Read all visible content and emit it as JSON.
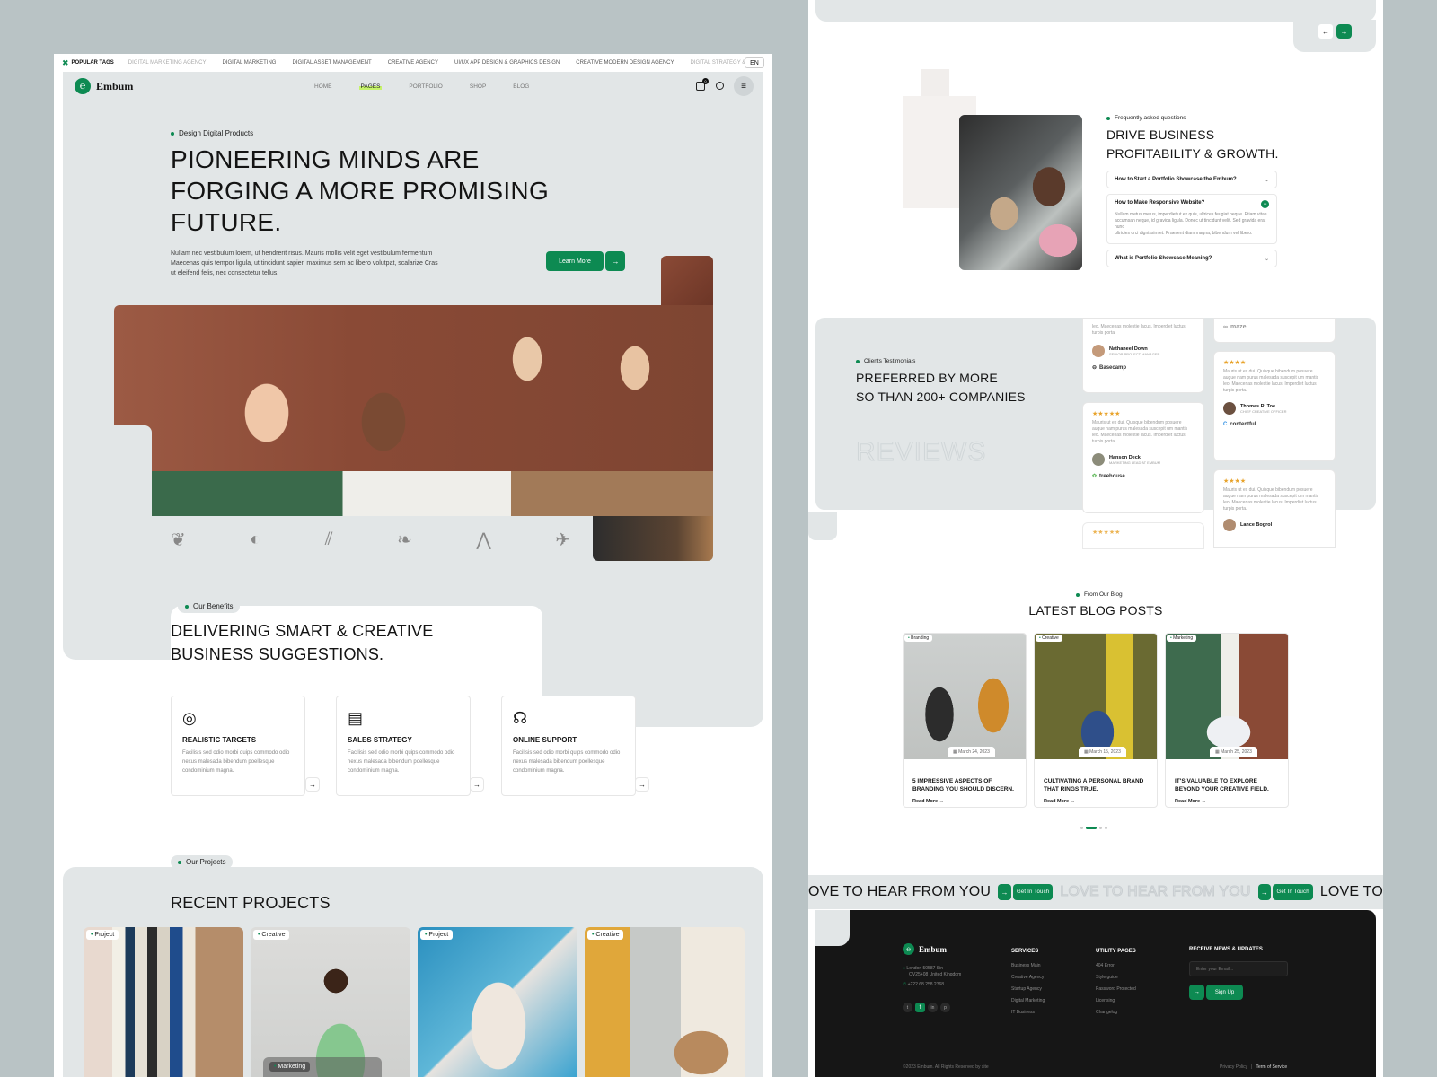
{
  "topbar": {
    "label": "POPULAR TAGS",
    "tags": [
      "DIGITAL MARKETING AGENCY",
      "DIGITAL MARKETING",
      "DIGITAL ASSET MANAGEMENT",
      "CREATIVE AGENCY",
      "UI/UX APP DESIGN & GRAPHICS DESIGN",
      "CREATIVE MODERN DESIGN AGENCY",
      "DIGITAL STRATEGY & BRA"
    ],
    "lang": "EN"
  },
  "brand": "Embum",
  "nav": [
    "HOME",
    "PAGES",
    "PORTFOLIO",
    "SHOP",
    "BLOG"
  ],
  "cart_count": "0",
  "hero": {
    "eyebrow": "Design Digital Products",
    "title_lines": [
      "PIONEERING MINDS ARE",
      "FORGING A MORE PROMISING",
      "FUTURE."
    ],
    "text_lines": [
      "Nullam nec vestibulum lorem, ut hendrerit risus. Mauris mollis velit eget vestibulum fermentum",
      "Maecenas quis tempor ligula, ut tincidunt sapien maximus sem ac libero volutpat, scalarize Cras",
      "ut eleifend felis, nec consectetur tellus."
    ],
    "button": "Learn More"
  },
  "benefits": {
    "eyebrow": "Our Benefits",
    "title_lines": [
      "DELIVERING SMART & CREATIVE",
      "BUSINESS SUGGESTIONS."
    ],
    "cards": [
      {
        "title": "REALISTIC TARGETS",
        "text_lines": [
          "Facilisis sed odio morbi quips commodo odio",
          "nexus malesada bibendum poellesque",
          "condominium magna."
        ]
      },
      {
        "title": "SALES STRATEGY",
        "text_lines": [
          "Facilisis sed odio morbi quips commodo odio",
          "nexus malesada bibendum poellesque",
          "condominium magna."
        ]
      },
      {
        "title": "ONLINE SUPPORT",
        "text_lines": [
          "Facilisis sed odio morbi quips commodo odio",
          "nexus malesada bibendum poellesque",
          "condominium magna."
        ]
      }
    ]
  },
  "projects": {
    "eyebrow": "Our Projects",
    "title": "RECENT PROJECTS",
    "tags": [
      "Project",
      "Creative",
      "Project",
      "Creative"
    ],
    "overlay": "Marketing"
  },
  "faq": {
    "eyebrow": "Frequently asked questions",
    "title_lines": [
      "DRIVE BUSINESS",
      "PROFITABILITY & GROWTH."
    ],
    "items": [
      {
        "q": "How to Start a Portfolio Showcase the Embum?"
      },
      {
        "q": "How to Make Responsive Website?",
        "a_lines": [
          "Nullam metus metus, imperdiet ut ex quis, ultrices feugiat neque. Etiam vitae",
          "accumsan neque, id gravida ligula. Donec ut tincidunt velit. Sed gravida erat nunc",
          "ultricies orci dignissim et. Praesent diam magna, bibendum vel libero."
        ]
      },
      {
        "q": "What is Portfolio Showcase Meaning?"
      }
    ]
  },
  "testimonials": {
    "eyebrow": "Clients Testimonials",
    "title_lines": [
      "PREFERRED BY MORE",
      "SO THAN 200+ COMPANIES"
    ],
    "watermark": "REVIEWS",
    "col1": [
      {
        "text_lines": [
          "leo. Maecenas molestie lacus. Imperdiet luctus",
          "turpis porta."
        ],
        "name": "Nathaneel Down",
        "role": "SENIOR PROJECT MANAGER",
        "logo": "Basecamp"
      },
      {
        "stars": "★★★★★",
        "text_lines": [
          "Mauris ut ex dui. Quisque bibendum posuere",
          "augue nam purus malesada suscepit um mantis",
          "leo. Maecenas molestie lacus. Imperdiet luctus",
          "turpis porta."
        ],
        "name": "Hanson Deck",
        "role": "MARKETING LEAD AT EMBUM",
        "logo": "treehouse"
      },
      {
        "stars": "★★★★★"
      }
    ],
    "col2": [
      {
        "logo": "maze"
      },
      {
        "stars": "★★★★",
        "text_lines": [
          "Mauris ut ex dui. Quisque bibendum posuere",
          "augue nam purus malesada suscepit um mantis",
          "leo. Maecenas molestie lacus. Imperdiet luctus",
          "turpis porta."
        ],
        "name": "Thomas R. Toe",
        "role": "CHIEF CREATIVE OFFICER",
        "logo": "contentful"
      },
      {
        "stars": "★★★★",
        "text_lines": [
          "Mauris ut ex dui. Quisque bibendum posuere",
          "augue nam purus malesada suscepit um mantis",
          "leo. Maecenas molestie lacus. Imperdiet luctus",
          "turpis porta."
        ],
        "name": "Lance Bogrol"
      }
    ]
  },
  "blog": {
    "eyebrow": "From Our Blog",
    "title": "LATEST BLOG POSTS",
    "read_more": "Read More →",
    "posts": [
      {
        "tag": "Branding",
        "date": "March 24, 2023",
        "title_lines": [
          "5 IMPRESSIVE ASPECTS OF",
          "BRANDING YOU SHOULD DISCERN."
        ]
      },
      {
        "tag": "Creative",
        "date": "March 15, 2023",
        "title_lines": [
          "CULTIVATING A PERSONAL BRAND",
          "THAT RINGS TRUE."
        ]
      },
      {
        "tag": "Marketing",
        "date": "March 25, 2023",
        "title_lines": [
          "IT'S VALUABLE TO EXPLORE",
          "BEYOND YOUR CREATIVE FIELD."
        ]
      }
    ]
  },
  "marquee": {
    "text1": "OVE TO HEAR FROM YOU",
    "text2": "LOVE TO HEAR FROM YOU",
    "text3": "LOVE TO",
    "button": "Get In Touch"
  },
  "footer": {
    "brand": "Embum",
    "address_lines": [
      "London 50587 Sin",
      "OV25+08 United Kingdom"
    ],
    "phone": "+222 68 258 2368",
    "services_title": "SERVICES",
    "services": [
      "Business Main",
      "Creative Agency",
      "Startup Agency",
      "Digital Marketing",
      "IT Business"
    ],
    "utility_title": "UTILITY PAGES",
    "utility": [
      "404 Error",
      "Style guide",
      "Password Protected",
      "Licensing",
      "Changelog"
    ],
    "news_title": "RECEIVE NEWS & UPDATES",
    "email_placeholder": "Enter your Email...",
    "signup": "Sign Up",
    "copyright": "©2023 Embum. All Rights Reserved by site",
    "privacy": "Privacy Policy",
    "terms": "Term of Service"
  },
  "colors": {
    "accent": "#0d8a52",
    "panel": "#e2e6e7",
    "dark": "#161616"
  }
}
